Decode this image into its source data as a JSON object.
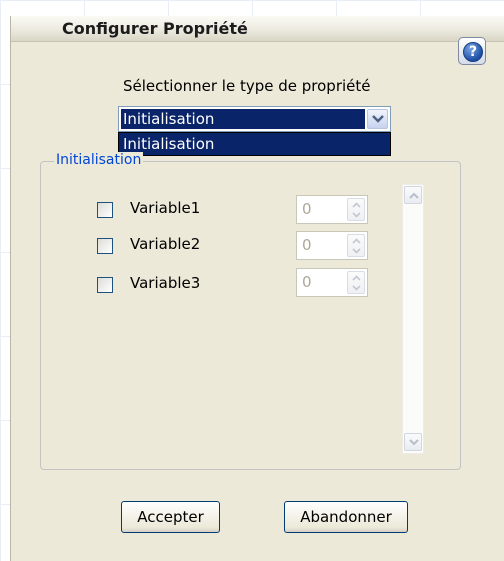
{
  "window": {
    "title": "Configurer Propriété"
  },
  "help_button": {
    "glyph": "?",
    "icon": "help-icon"
  },
  "property_type": {
    "label": "Sélectionner le type de propriété",
    "selected": "Initialisation",
    "options": [
      "Initialisation"
    ]
  },
  "group": {
    "legend": "Initialisation",
    "variables": [
      {
        "name": "Variable1",
        "checked": false,
        "value": "0"
      },
      {
        "name": "Variable2",
        "checked": false,
        "value": "0"
      },
      {
        "name": "Variable3",
        "checked": false,
        "value": "0"
      }
    ]
  },
  "buttons": {
    "accept": "Accepter",
    "cancel": "Abandonner"
  },
  "colors": {
    "selection": "#0a246a",
    "dialog_bg": "#ece9d8",
    "legend_text": "#0046d5"
  }
}
